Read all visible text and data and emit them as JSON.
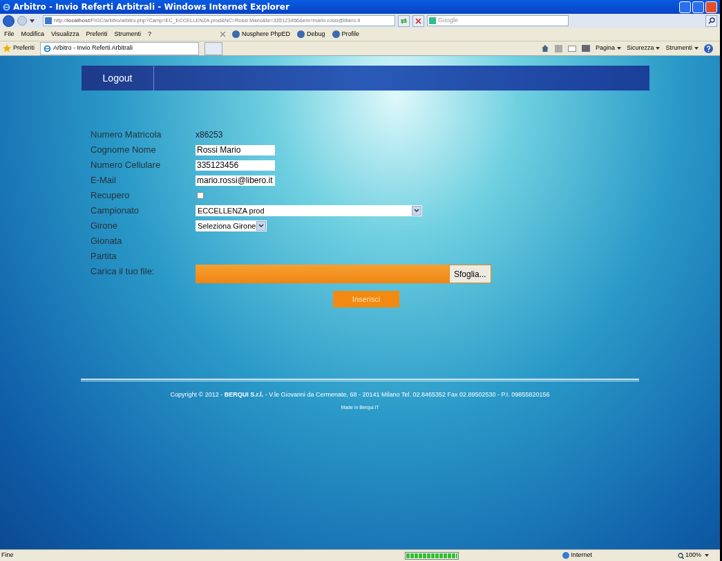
{
  "window": {
    "title": "Arbitro - Invio Referti Arbitrali - Windows Internet Explorer"
  },
  "address_bar": {
    "url": "http://**localhost**/FIGC/arbitro/arbitro.php?Camp=EC_ECCELLENZA prod&NC=Rossi Mario&te=335123456&em=mario.rossi@libero.it",
    "search_placeholder": "Google"
  },
  "menu": [
    "File",
    "Modifica",
    "Visualizza",
    "Preferiti",
    "Strumenti",
    "?"
  ],
  "toolbar": [
    {
      "label": "Nusphere PhpED"
    },
    {
      "label": "Debug"
    },
    {
      "label": "Profile"
    }
  ],
  "favorites": {
    "label": "Preferiti",
    "tabs": [
      {
        "label": "Arbitro - Invio Referti Arbitrali",
        "selected": true
      }
    ]
  },
  "command_bar": [
    "Pagina",
    "Sicurezza",
    "Strumenti"
  ],
  "page": {
    "nav": [
      "Logout"
    ],
    "form": [
      {
        "kind": "text",
        "label": "Numero Matricola",
        "value": "x86253"
      },
      {
        "kind": "input",
        "label": "Cognome Nome",
        "value": "Rossi Mario"
      },
      {
        "kind": "input",
        "label": "Numero Cellulare",
        "value": "335123456"
      },
      {
        "kind": "input",
        "label": "E-Mail",
        "value": "mario.rossi@libero.it"
      },
      {
        "kind": "checkbox",
        "label": "Recupero",
        "checked": false
      },
      {
        "kind": "select",
        "label": "Campionato",
        "value": "ECCELLENZA prod",
        "wide": true
      },
      {
        "kind": "select",
        "label": "Girone",
        "value": "Seleziona Girone",
        "wide": false
      },
      {
        "kind": "empty",
        "label": "Gionata"
      },
      {
        "kind": "empty",
        "label": "Partita"
      },
      {
        "kind": "file",
        "label": "Carica il tuo file:",
        "button": "Sfoglia..."
      }
    ],
    "submit": "Inserisci",
    "footer": {
      "copyright": "Copyright © 2012 - **BERQUI S.r.l.** - V.le Giovanni da Cermenate, 68 - 20141 Milano Tel. 02.8465352 Fax 02.89502530 - P.I. 09855820156",
      "made_in": "Made in Berqui.IT"
    }
  },
  "status_bar": {
    "text": "Fine",
    "progress": {
      "level": 1
    },
    "zone": "Internet",
    "zoom": "100%"
  }
}
